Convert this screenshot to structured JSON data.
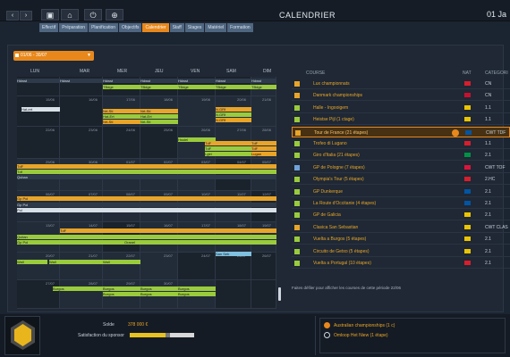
{
  "topbar": {
    "title": "CALENDRIER",
    "date": "01 Ja",
    "icons": [
      "chevron-left-icon",
      "chevron-right-icon",
      "briefcase-icon",
      "building-icon",
      "power-icon",
      "globe-icon"
    ]
  },
  "tabs": [
    "Effectif",
    "Préparation",
    "Planification",
    "Objectifs",
    "Calendrier",
    "Staff",
    "Stages",
    "Matériel",
    "Formation"
  ],
  "calendar": {
    "range": "01/06 - 30/07",
    "days": [
      "LUN",
      "MAR",
      "MER",
      "JEU",
      "VEN",
      "SAM",
      "DIM"
    ]
  },
  "races_panel": {
    "headers": {
      "course": "COURSE",
      "nat": "NAT",
      "categorie": "CATEGORI"
    },
    "races": [
      {
        "name": "Lux championnats",
        "color": "#e8a529",
        "cat": "CN"
      },
      {
        "name": "Danmark championships",
        "color": "#e8a529",
        "cat": "CN"
      },
      {
        "name": "Halle - Ingooigem",
        "color": "#9acb3d",
        "cat": "1.1"
      },
      {
        "name": "Heistse Pijl (1 ctage)",
        "color": "#9acb3d",
        "cat": "1.1"
      },
      {
        "name": "Tour de France (21 étapes)",
        "color": "#e8a529",
        "cat": "CWT TDF"
      },
      {
        "name": "Trofeo di Lugano",
        "color": "#9acb3d",
        "cat": "1.1"
      },
      {
        "name": "Giro d'Italia (21 étapes)",
        "color": "#9acb3d",
        "cat": "2.1"
      },
      {
        "name": "GP de Pologne (7 étapes)",
        "color": "#6fa3d8",
        "cat": "CWT TOF"
      },
      {
        "name": "Olympia's Tour (5 étapes)",
        "color": "#9acb3d",
        "cat": "2.HC"
      },
      {
        "name": "GP Dunkerque",
        "color": "#9acb3d",
        "cat": "2.1"
      },
      {
        "name": "La Route d'Occitanie (4 étapes)",
        "color": "#9acb3d",
        "cat": "2.1"
      },
      {
        "name": "GP de Galicia",
        "color": "#9acb3d",
        "cat": "2.1"
      },
      {
        "name": "Clasica San Sebastian",
        "color": "#e8a529",
        "cat": "CWT CLAS"
      },
      {
        "name": "Vuelta a Burgos (5 étapes)",
        "color": "#9acb3d",
        "cat": "2.1"
      },
      {
        "name": "Circuito de Getxo (5 étapes)",
        "color": "#9acb3d",
        "cat": "2.1"
      },
      {
        "name": "Vuelta a Portugal (10 étapes)",
        "color": "#9acb3d",
        "cat": "2.1"
      }
    ],
    "note": "Faites défiler pour afficher les courses de cette période 22/06"
  },
  "bottom": {
    "solde_label": "Solde",
    "solde_value": "378 000 €",
    "sponsor_label": "Satisfaction du sponsor",
    "sponsor_level": 0.55,
    "list": [
      {
        "text": "Australian championships (1 c)"
      },
      {
        "text": "Omloop Het Niew (1 étape)"
      }
    ]
  }
}
